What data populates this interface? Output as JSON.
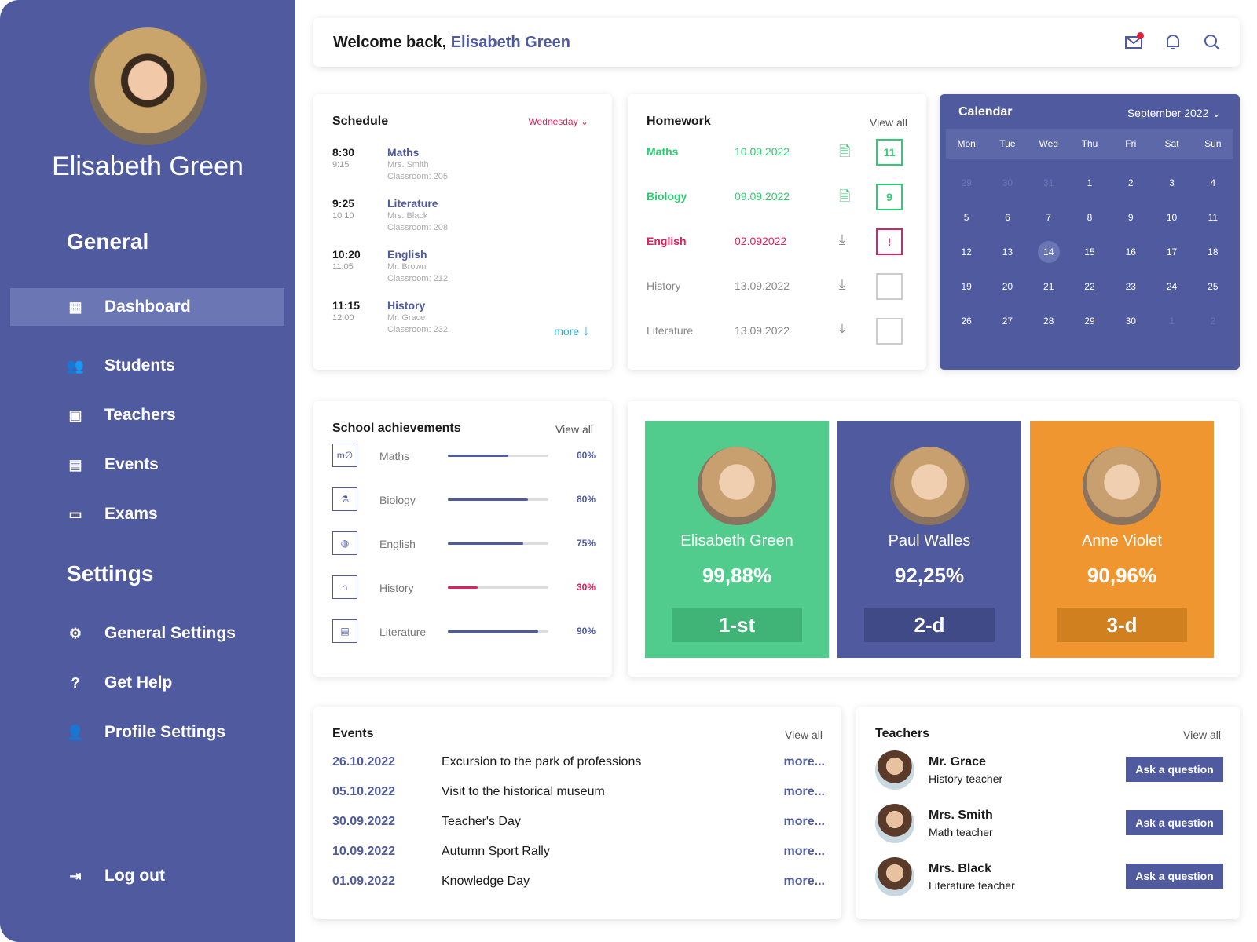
{
  "user": {
    "name": "Elisabeth Green"
  },
  "sidebar": {
    "general_title": "General",
    "settings_title": "Settings",
    "general_items": [
      {
        "label": "Dashboard",
        "icon": "dashboard-icon"
      },
      {
        "label": "Students",
        "icon": "students-icon"
      },
      {
        "label": "Teachers",
        "icon": "teachers-icon"
      },
      {
        "label": "Events",
        "icon": "events-icon"
      },
      {
        "label": "Exams",
        "icon": "exams-icon"
      }
    ],
    "settings_items": [
      {
        "label": "General Settings",
        "icon": "gear-icon"
      },
      {
        "label": "Get Help",
        "icon": "help-icon"
      },
      {
        "label": "Profile Settings",
        "icon": "profile-settings-icon"
      }
    ],
    "logout": "Log out"
  },
  "header": {
    "welcome": "Welcome back,",
    "name": "Elisabeth Green",
    "mail_badge": "1"
  },
  "schedule": {
    "title": "Schedule",
    "day": "Wednesday",
    "more": "more",
    "items": [
      {
        "start": "8:30",
        "end": "9:15",
        "subject": "Maths",
        "teacher": "Mrs. Smith",
        "room": "Classroom: 205"
      },
      {
        "start": "9:25",
        "end": "10:10",
        "subject": "Literature",
        "teacher": "Mrs. Black",
        "room": "Classroom: 208"
      },
      {
        "start": "10:20",
        "end": "11:05",
        "subject": "English",
        "teacher": "Mr. Brown",
        "room": "Classroom: 212"
      },
      {
        "start": "11:15",
        "end": "12:00",
        "subject": "History",
        "teacher": "Mr. Grace",
        "room": "Classroom: 232"
      }
    ]
  },
  "homework": {
    "title": "Homework",
    "view_all": "View all",
    "items": [
      {
        "subject": "Maths",
        "date": "10.09.2022",
        "grade": "11",
        "status": "graded",
        "color": "#2ecc71"
      },
      {
        "subject": "Biology",
        "date": "09.09.2022",
        "grade": "9",
        "status": "graded",
        "color": "#2ecc71"
      },
      {
        "subject": "English",
        "date": "02.092022",
        "grade": "!",
        "status": "overdue",
        "color": "#e0205c"
      },
      {
        "subject": "History",
        "date": "13.09.2022",
        "grade": "",
        "status": "pending",
        "color": "#888888"
      },
      {
        "subject": "Literature",
        "date": "13.09.2022",
        "grade": "",
        "status": "pending",
        "color": "#888888"
      }
    ]
  },
  "calendar": {
    "title": "Calendar",
    "month": "September 2022",
    "weekdays": [
      "Mon",
      "Tue",
      "Wed",
      "Thu",
      "Fri",
      "Sat",
      "Sun"
    ],
    "weeks": [
      [
        "29",
        "30",
        "31",
        "1",
        "2",
        "3",
        "4"
      ],
      [
        "5",
        "6",
        "7",
        "8",
        "9",
        "10",
        "11"
      ],
      [
        "12",
        "13",
        "14",
        "15",
        "16",
        "17",
        "18"
      ],
      [
        "19",
        "20",
        "21",
        "22",
        "23",
        "24",
        "25"
      ],
      [
        "26",
        "27",
        "28",
        "29",
        "30",
        "1",
        "2"
      ]
    ],
    "today": "14"
  },
  "achievements": {
    "title": "School achievements",
    "view_all": "View all",
    "items": [
      {
        "subject": "Maths",
        "percent": 60,
        "label": "60%",
        "icon": "maths-icon"
      },
      {
        "subject": "Biology",
        "percent": 80,
        "label": "80%",
        "icon": "microscope-icon"
      },
      {
        "subject": "English",
        "percent": 75,
        "label": "75%",
        "icon": "globe-icon"
      },
      {
        "subject": "History",
        "percent": 30,
        "label": "30%",
        "icon": "building-icon"
      },
      {
        "subject": "Literature",
        "percent": 90,
        "label": "90%",
        "icon": "book-icon"
      }
    ]
  },
  "top_students": [
    {
      "name": "Elisabeth Green",
      "score": "99,88%",
      "rank": "1-st",
      "color": "#52cc8c",
      "rank_bg": "#3fb476"
    },
    {
      "name": "Paul Walles",
      "score": "92,25%",
      "rank": "2-d",
      "color": "#4f5b9e",
      "rank_bg": "#404a86"
    },
    {
      "name": "Anne Violet",
      "score": "90,96%",
      "rank": "3-d",
      "color": "#ef9630",
      "rank_bg": "#d0801e"
    }
  ],
  "events": {
    "title": "Events",
    "view_all": "View all",
    "items": [
      {
        "date": "26.10.2022",
        "name": "Excursion to the park of professions",
        "more": "more..."
      },
      {
        "date": "05.10.2022",
        "name": "Visit to the historical museum",
        "more": "more..."
      },
      {
        "date": "30.09.2022",
        "name": "Teacher's Day",
        "more": "more..."
      },
      {
        "date": "10.09.2022",
        "name": "Autumn Sport Rally",
        "more": "more..."
      },
      {
        "date": "01.09.2022",
        "name": "Knowledge Day",
        "more": "more..."
      }
    ]
  },
  "teachers": {
    "title": "Teachers",
    "view_all": "View all",
    "items": [
      {
        "name": "Mr. Grace",
        "role": "History teacher",
        "button": "Ask a question"
      },
      {
        "name": "Mrs. Smith",
        "role": "Math teacher",
        "button": "Ask a question"
      },
      {
        "name": "Mrs. Black",
        "role": "Literature teacher",
        "button": "Ask a question"
      }
    ]
  }
}
